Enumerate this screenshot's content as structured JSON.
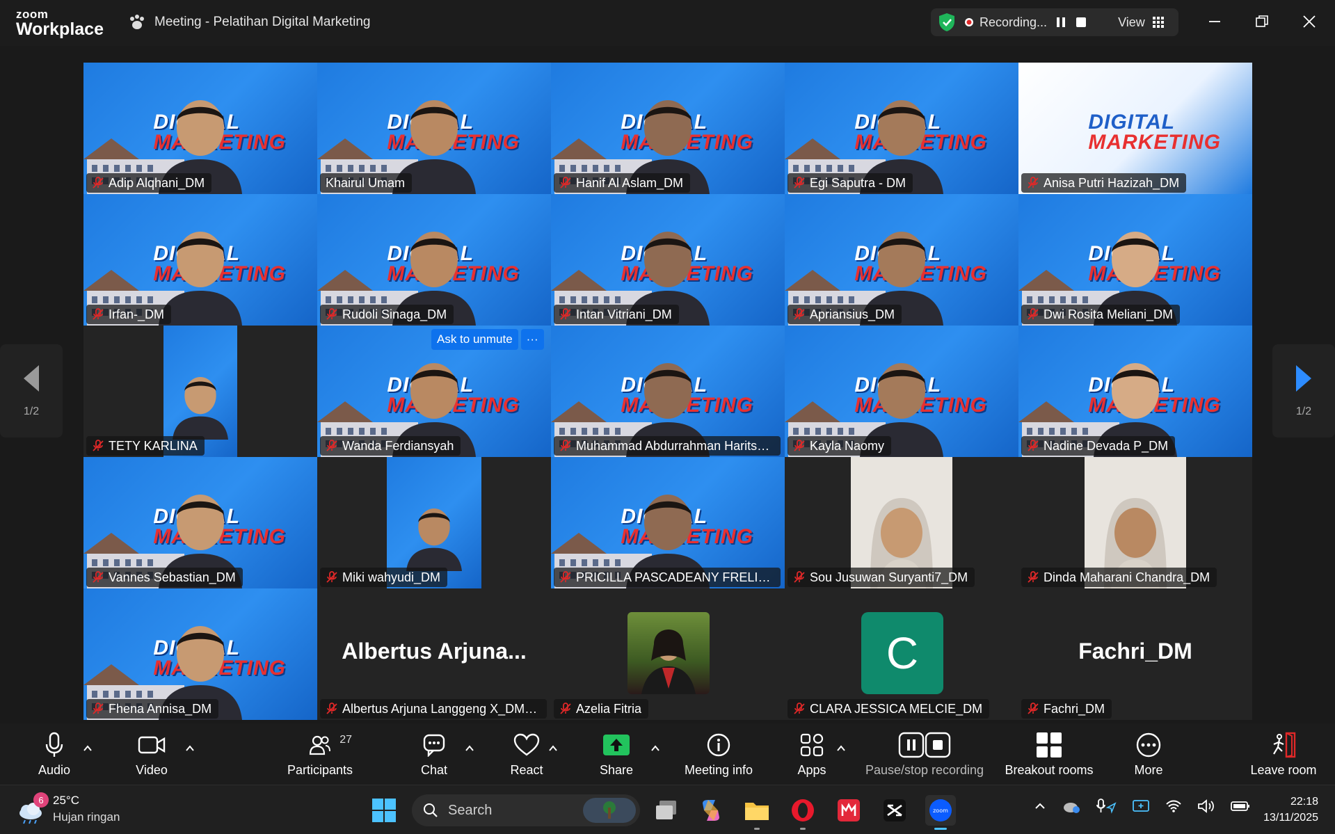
{
  "app": {
    "brand_line1": "zoom",
    "brand_line2": "Workplace",
    "meeting_title": "Meeting - Pelatihan Digital Marketing"
  },
  "recording": {
    "status": "Recording...",
    "view_label": "View"
  },
  "pager": {
    "label": "1/2"
  },
  "tile_overlay": {
    "ask_unmute": "Ask to unmute",
    "more": "···"
  },
  "participants": [
    {
      "name": "Adip Alqhani_DM",
      "muted": true
    },
    {
      "name": "Khairul Umam",
      "muted": false
    },
    {
      "name": "Hanif Al Aslam_DM",
      "muted": true
    },
    {
      "name": "Egi Saputra - DM",
      "muted": true
    },
    {
      "name": "Anisa Putri Hazizah_DM",
      "muted": true
    },
    {
      "name": "Irfan-_DM",
      "muted": true
    },
    {
      "name": "Rudoli Sinaga_DM",
      "muted": true
    },
    {
      "name": "Intan Vitriani_DM",
      "muted": true
    },
    {
      "name": "Apriansius_DM",
      "muted": true
    },
    {
      "name": "Dwi Rosita Meliani_DM",
      "muted": true
    },
    {
      "name": "TETY KARLINA",
      "muted": true
    },
    {
      "name": "Wanda Ferdiansyah",
      "muted": true
    },
    {
      "name": "Muhammad Abdurrahman Harits_...",
      "muted": true
    },
    {
      "name": "Kayla Naomy",
      "muted": true
    },
    {
      "name": "Nadine Devada P_DM",
      "muted": true
    },
    {
      "name": "Vannes Sebastian_DM",
      "muted": true
    },
    {
      "name": "Miki wahyudi_DM",
      "muted": true
    },
    {
      "name": "PRICILLA PASCADEANY FRELIANS...",
      "muted": true
    },
    {
      "name": "Sou Jusuwan Suryanti7_DM",
      "muted": true
    },
    {
      "name": "Dinda Maharani Chandra_DM",
      "muted": true
    },
    {
      "name": "Fhena Annisa_DM",
      "muted": true
    },
    {
      "name": "Albertus Arjunа Langgeng X_DM_...",
      "muted": true,
      "display_name": "Albertus  Arjuna..."
    },
    {
      "name": "Azelia Fitria",
      "muted": true
    },
    {
      "name": "CLARA JESSICA MELCIE_DM",
      "muted": true,
      "avatar_letter": "C"
    },
    {
      "name": "Fachri_DM",
      "muted": true,
      "display_name": "Fachri_DM"
    }
  ],
  "logo_text": {
    "line1": "DIGITAL",
    "line2": "MARKETING"
  },
  "toolbar": {
    "audio": "Audio",
    "video": "Video",
    "participants": "Participants",
    "participants_count": "27",
    "chat": "Chat",
    "react": "React",
    "share": "Share",
    "meeting_info": "Meeting info",
    "apps": "Apps",
    "pause_recording": "Pause/stop recording",
    "breakout": "Breakout rooms",
    "more": "More",
    "leave": "Leave room"
  },
  "taskbar": {
    "weather_temp": "25°C",
    "weather_desc": "Hujan ringan",
    "weather_badge": "6",
    "search_placeholder": "Search",
    "time": "22:18",
    "date": "13/11/2025"
  },
  "colors": {
    "accent": "#0e72ed",
    "active_speaker": "#2ee08a",
    "mute_red": "#e02828",
    "share_green": "#22c35d"
  }
}
